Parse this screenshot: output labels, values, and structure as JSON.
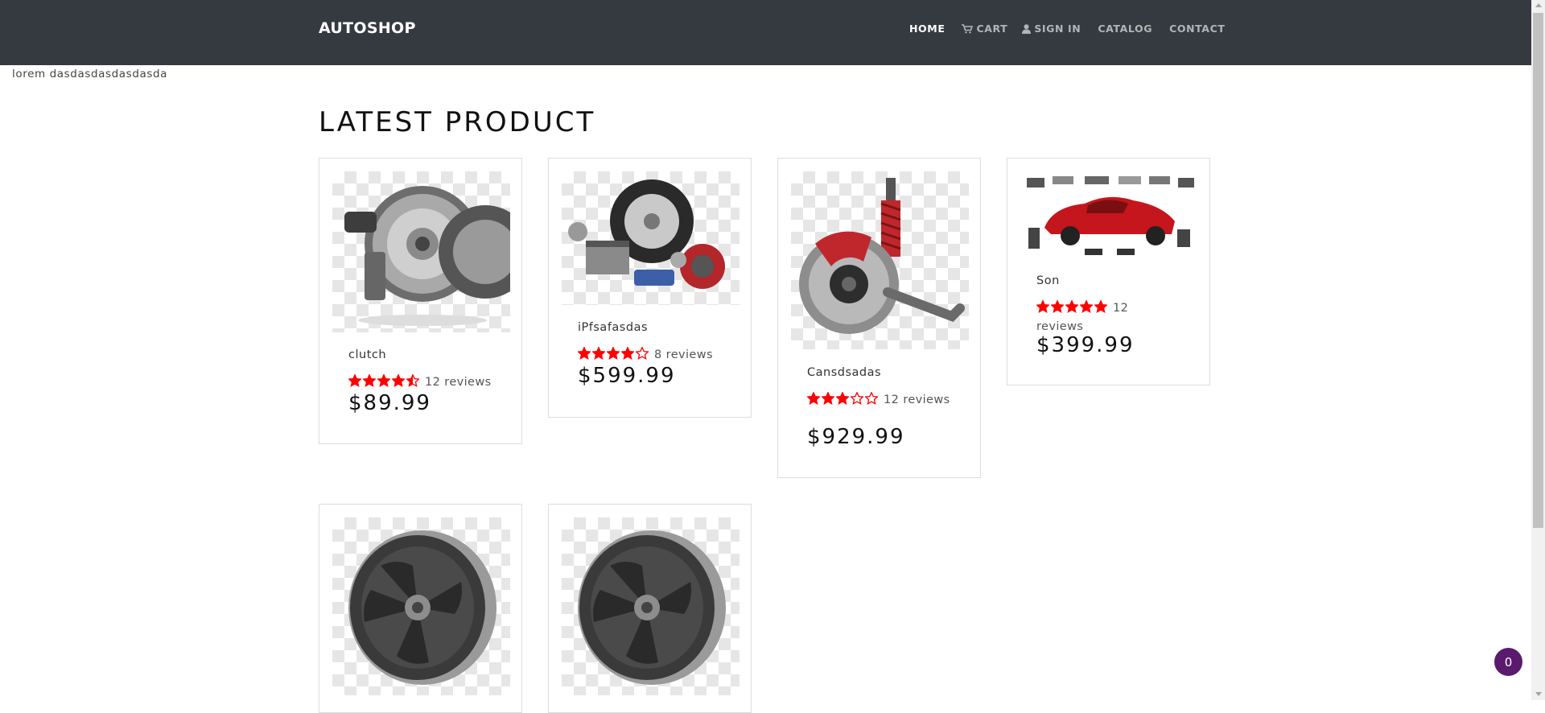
{
  "brand": "AUTOSHOP",
  "nav": {
    "home": "HOME",
    "cart": "CART",
    "signin": "SIGN IN",
    "catalog": "CATALOG",
    "contact": "CONTACT"
  },
  "lorem": "lorem dasdasdasdasdasda",
  "section_title": "LATEST PRODUCT",
  "products": [
    {
      "name": "clutch",
      "rating": 4.5,
      "reviews_text": "12 reviews",
      "price": "$89.99",
      "image_icon": "clutch-kit-image"
    },
    {
      "name": "iPfsafasdas",
      "rating": 4,
      "reviews_text": "8 reviews",
      "price": "$599.99",
      "image_icon": "auto-parts-image"
    },
    {
      "name": "Cansdsadas",
      "rating": 3,
      "reviews_text": "12 reviews",
      "price": "$929.99",
      "image_icon": "brake-suspension-image"
    },
    {
      "name": "Son",
      "rating": 5,
      "reviews_text": "12 reviews",
      "price": "$399.99",
      "image_icon": "car-body-parts-image"
    },
    {
      "name": "",
      "image_icon": "alloy-wheel-image"
    },
    {
      "name": "",
      "image_icon": "alloy-wheel-image"
    }
  ],
  "cart_badge": "0",
  "colors": {
    "navbar": "#343a40",
    "star": "#ff0000",
    "badge": "#5a1a6e"
  }
}
